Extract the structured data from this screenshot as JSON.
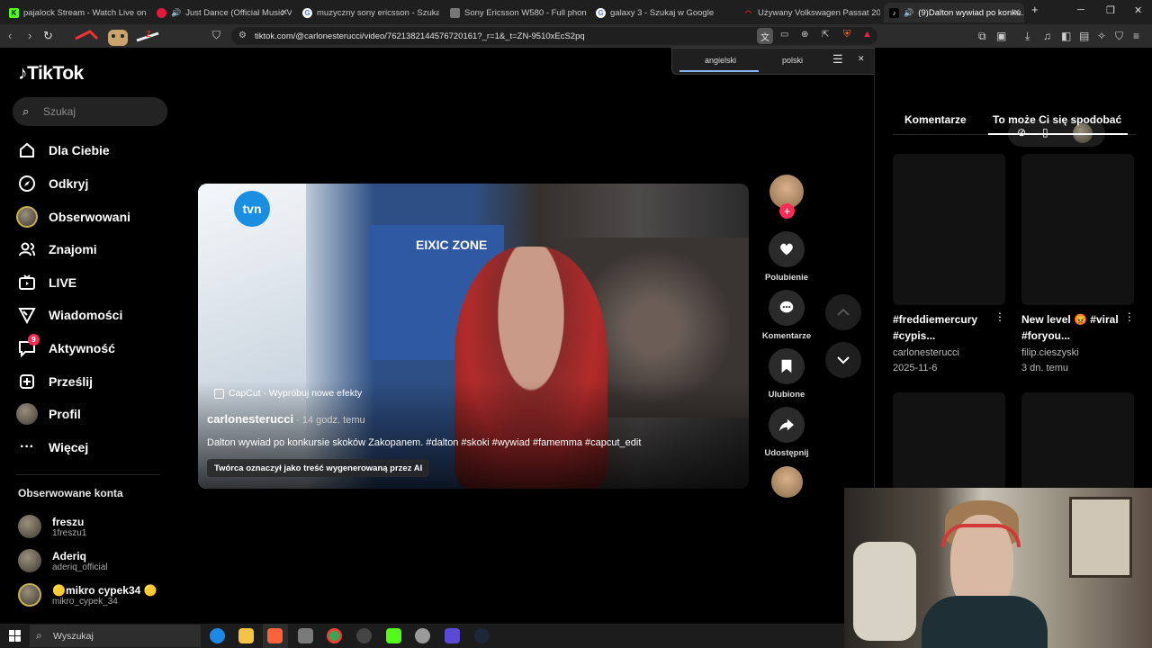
{
  "browser": {
    "tabs": [
      {
        "label": "pajalock Stream - Watch Live on Kick",
        "favicon": "kick-icon",
        "color": "#53fc18"
      },
      {
        "label": "Just Dance (Official Music Vi...",
        "favicon": "audio-icon",
        "color": "#e3193d"
      },
      {
        "label": "muzyczny sony ericsson - Szukaj w G...",
        "favicon": "google-icon",
        "color": "#ffffff"
      },
      {
        "label": "Sony Ericsson W580 - Full phone sp...",
        "favicon": "page-icon",
        "color": "#888888"
      },
      {
        "label": "galaxy 3 - Szukaj w Google",
        "favicon": "google-icon",
        "color": "#ffffff"
      },
      {
        "label": "Używany Volkswagen Passat 2005 - ...",
        "favicon": "otomoto-icon",
        "color": "#e02020"
      },
      {
        "label": "(9)Dalton wywiad po konku...",
        "favicon": "tiktok-icon",
        "color": "#ffffff"
      }
    ],
    "new_tab": "+",
    "url": "tiktok.com/@carlonesterucci/video/7621382144576720161?_r=1&_t=ZN-9510xEcS2pq"
  },
  "translate": {
    "source": "angielski",
    "target": "polski"
  },
  "sidebar": {
    "logo": "TikTok",
    "search_placeholder": "Szukaj",
    "items": [
      {
        "label": "Dla Ciebie",
        "icon": "home-icon"
      },
      {
        "label": "Odkryj",
        "icon": "compass-icon"
      },
      {
        "label": "Obserwowani",
        "icon": "following-avatar-icon"
      },
      {
        "label": "Znajomi",
        "icon": "friends-icon"
      },
      {
        "label": "LIVE",
        "icon": "live-icon"
      },
      {
        "label": "Wiadomości",
        "icon": "send-icon"
      },
      {
        "label": "Aktywność",
        "icon": "activity-icon",
        "badge": "9"
      },
      {
        "label": "Prześlij",
        "icon": "upload-icon"
      },
      {
        "label": "Profil",
        "icon": "profile-avatar-icon"
      },
      {
        "label": "Więcej",
        "icon": "more-icon"
      }
    ],
    "following_header": "Obserwowane konta",
    "following": [
      {
        "name": "freszu",
        "handle": "1freszu1"
      },
      {
        "name": "Aderiq",
        "handle": "aderiq_official"
      },
      {
        "name": "🟡mikro cypek34 🟡",
        "handle": "mikro_cypek_34"
      }
    ]
  },
  "video": {
    "channel_logo": "tvn",
    "banner_text": "EIXIC ZONE",
    "capcut": "CapCut · Wypróbuj nowe efekty",
    "author": "carlonesterucci",
    "time_ago": " · 14 godz. temu",
    "caption": "Dalton wywiad po konkursie skoków Zakopanem. #dalton #skoki #wywiad #famemma #capcut_edit",
    "ai_label": "Twórca oznaczył jako treść wygenerowaną przez AI"
  },
  "actions": {
    "like": "Polubienie",
    "comments": "Komentarze",
    "save": "Ulubione",
    "share": "Udostępnij"
  },
  "right_panel": {
    "tabs": [
      "Komentarze",
      "To może Ci się spodobać"
    ],
    "videos": [
      {
        "title": "#freddiemercury #cypis...",
        "author": "carlonesterucci",
        "date": "2025-11-6"
      },
      {
        "title": "New level 😡 #viral #foryou...",
        "author": "filip.cieszyski",
        "date": "3 dn. temu"
      }
    ]
  },
  "taskbar": {
    "search_placeholder": "Wyszukaj"
  },
  "colors": {
    "accent": "#fe2c55",
    "active_tab_underline": "#ffffff"
  }
}
